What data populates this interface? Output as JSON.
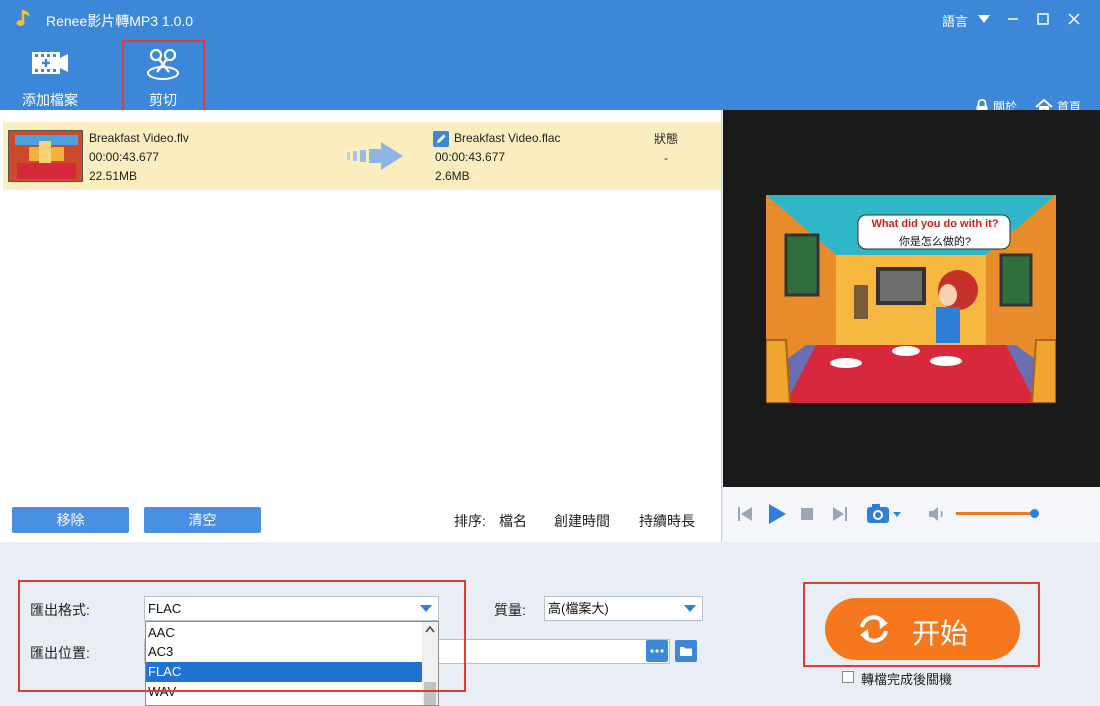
{
  "window": {
    "title": "Renee影片轉MP3 1.0.0",
    "language": "語言"
  },
  "toolbar": {
    "add_file": "添加檔案",
    "cut": "剪切",
    "about": "關於",
    "home": "首頁"
  },
  "file": {
    "source_name": "Breakfast Video.flv",
    "source_duration": "00:00:43.677",
    "source_size": "22.51MB",
    "output_name": "Breakfast Video.flac",
    "output_duration": "00:00:43.677",
    "output_size": "2.6MB",
    "status_header": "狀態",
    "status_value": "-"
  },
  "list_actions": {
    "remove": "移除",
    "clear": "清空"
  },
  "sort": {
    "label": "排序:",
    "by_name": "檔名",
    "by_created": "創建時間",
    "by_duration": "持續時長"
  },
  "preview": {
    "speech_en": "What did you do with it?",
    "speech_zh": "你是怎么做的?"
  },
  "player": {
    "volume_level": 0.95
  },
  "output": {
    "format_label": "匯出格式:",
    "format_value": "FLAC",
    "location_label": "匯出位置:",
    "quality_label": "質量:",
    "quality_value": "高(檔案大)",
    "format_options": [
      "AAC",
      "AC3",
      "FLAC",
      "WAV"
    ],
    "selected_option": "FLAC"
  },
  "start": {
    "label": "开始",
    "shutdown_label": "轉檔完成後關機"
  },
  "colors": {
    "accent": "#3d87d8",
    "start": "#f5781f",
    "highlight_row": "#faeec1",
    "selected_item": "#1f74d1",
    "annotation": "#e23b36"
  }
}
